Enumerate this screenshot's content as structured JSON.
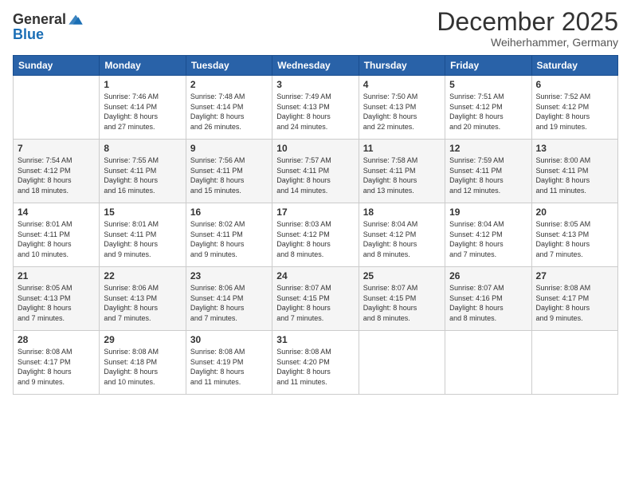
{
  "header": {
    "logo_general": "General",
    "logo_blue": "Blue",
    "month": "December 2025",
    "location": "Weiherhammer, Germany"
  },
  "days_of_week": [
    "Sunday",
    "Monday",
    "Tuesday",
    "Wednesday",
    "Thursday",
    "Friday",
    "Saturday"
  ],
  "weeks": [
    [
      {
        "num": "",
        "info": ""
      },
      {
        "num": "1",
        "info": "Sunrise: 7:46 AM\nSunset: 4:14 PM\nDaylight: 8 hours\nand 27 minutes."
      },
      {
        "num": "2",
        "info": "Sunrise: 7:48 AM\nSunset: 4:14 PM\nDaylight: 8 hours\nand 26 minutes."
      },
      {
        "num": "3",
        "info": "Sunrise: 7:49 AM\nSunset: 4:13 PM\nDaylight: 8 hours\nand 24 minutes."
      },
      {
        "num": "4",
        "info": "Sunrise: 7:50 AM\nSunset: 4:13 PM\nDaylight: 8 hours\nand 22 minutes."
      },
      {
        "num": "5",
        "info": "Sunrise: 7:51 AM\nSunset: 4:12 PM\nDaylight: 8 hours\nand 20 minutes."
      },
      {
        "num": "6",
        "info": "Sunrise: 7:52 AM\nSunset: 4:12 PM\nDaylight: 8 hours\nand 19 minutes."
      }
    ],
    [
      {
        "num": "7",
        "info": "Sunrise: 7:54 AM\nSunset: 4:12 PM\nDaylight: 8 hours\nand 18 minutes."
      },
      {
        "num": "8",
        "info": "Sunrise: 7:55 AM\nSunset: 4:11 PM\nDaylight: 8 hours\nand 16 minutes."
      },
      {
        "num": "9",
        "info": "Sunrise: 7:56 AM\nSunset: 4:11 PM\nDaylight: 8 hours\nand 15 minutes."
      },
      {
        "num": "10",
        "info": "Sunrise: 7:57 AM\nSunset: 4:11 PM\nDaylight: 8 hours\nand 14 minutes."
      },
      {
        "num": "11",
        "info": "Sunrise: 7:58 AM\nSunset: 4:11 PM\nDaylight: 8 hours\nand 13 minutes."
      },
      {
        "num": "12",
        "info": "Sunrise: 7:59 AM\nSunset: 4:11 PM\nDaylight: 8 hours\nand 12 minutes."
      },
      {
        "num": "13",
        "info": "Sunrise: 8:00 AM\nSunset: 4:11 PM\nDaylight: 8 hours\nand 11 minutes."
      }
    ],
    [
      {
        "num": "14",
        "info": "Sunrise: 8:01 AM\nSunset: 4:11 PM\nDaylight: 8 hours\nand 10 minutes."
      },
      {
        "num": "15",
        "info": "Sunrise: 8:01 AM\nSunset: 4:11 PM\nDaylight: 8 hours\nand 9 minutes."
      },
      {
        "num": "16",
        "info": "Sunrise: 8:02 AM\nSunset: 4:11 PM\nDaylight: 8 hours\nand 9 minutes."
      },
      {
        "num": "17",
        "info": "Sunrise: 8:03 AM\nSunset: 4:12 PM\nDaylight: 8 hours\nand 8 minutes."
      },
      {
        "num": "18",
        "info": "Sunrise: 8:04 AM\nSunset: 4:12 PM\nDaylight: 8 hours\nand 8 minutes."
      },
      {
        "num": "19",
        "info": "Sunrise: 8:04 AM\nSunset: 4:12 PM\nDaylight: 8 hours\nand 7 minutes."
      },
      {
        "num": "20",
        "info": "Sunrise: 8:05 AM\nSunset: 4:13 PM\nDaylight: 8 hours\nand 7 minutes."
      }
    ],
    [
      {
        "num": "21",
        "info": "Sunrise: 8:05 AM\nSunset: 4:13 PM\nDaylight: 8 hours\nand 7 minutes."
      },
      {
        "num": "22",
        "info": "Sunrise: 8:06 AM\nSunset: 4:13 PM\nDaylight: 8 hours\nand 7 minutes."
      },
      {
        "num": "23",
        "info": "Sunrise: 8:06 AM\nSunset: 4:14 PM\nDaylight: 8 hours\nand 7 minutes."
      },
      {
        "num": "24",
        "info": "Sunrise: 8:07 AM\nSunset: 4:15 PM\nDaylight: 8 hours\nand 7 minutes."
      },
      {
        "num": "25",
        "info": "Sunrise: 8:07 AM\nSunset: 4:15 PM\nDaylight: 8 hours\nand 8 minutes."
      },
      {
        "num": "26",
        "info": "Sunrise: 8:07 AM\nSunset: 4:16 PM\nDaylight: 8 hours\nand 8 minutes."
      },
      {
        "num": "27",
        "info": "Sunrise: 8:08 AM\nSunset: 4:17 PM\nDaylight: 8 hours\nand 9 minutes."
      }
    ],
    [
      {
        "num": "28",
        "info": "Sunrise: 8:08 AM\nSunset: 4:17 PM\nDaylight: 8 hours\nand 9 minutes."
      },
      {
        "num": "29",
        "info": "Sunrise: 8:08 AM\nSunset: 4:18 PM\nDaylight: 8 hours\nand 10 minutes."
      },
      {
        "num": "30",
        "info": "Sunrise: 8:08 AM\nSunset: 4:19 PM\nDaylight: 8 hours\nand 11 minutes."
      },
      {
        "num": "31",
        "info": "Sunrise: 8:08 AM\nSunset: 4:20 PM\nDaylight: 8 hours\nand 11 minutes."
      },
      {
        "num": "",
        "info": ""
      },
      {
        "num": "",
        "info": ""
      },
      {
        "num": "",
        "info": ""
      }
    ]
  ]
}
